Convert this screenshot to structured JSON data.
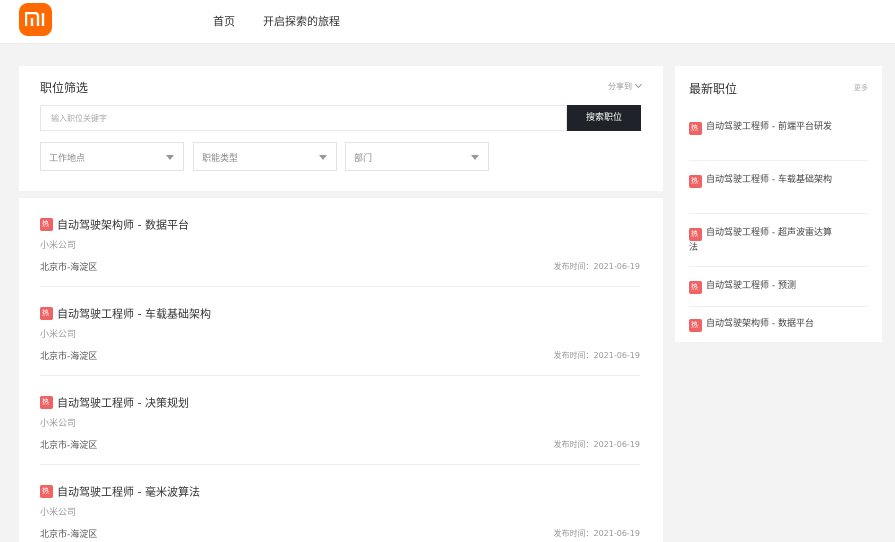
{
  "header": {
    "logo_icon": "mi-logo-icon",
    "brand_color": "#ff6900",
    "nav": [
      {
        "label": "首页"
      },
      {
        "label": "开启探索的旅程"
      }
    ]
  },
  "filter": {
    "title": "职位筛选",
    "share_label": "分享到",
    "search_placeholder": "输入职位关键字",
    "search_button": "搜索职位",
    "selects": [
      {
        "label": "工作地点"
      },
      {
        "label": "职能类型"
      },
      {
        "label": "部门"
      }
    ]
  },
  "jobs": [
    {
      "title": "自动驾驶架构师 - 数据平台",
      "company": "小米公司",
      "location": "北京市-海淀区",
      "date": "发布时间：2021-06-19"
    },
    {
      "title": "自动驾驶工程师 - 车载基础架构",
      "company": "小米公司",
      "location": "北京市-海淀区",
      "date": "发布时间：2021-06-19"
    },
    {
      "title": "自动驾驶工程师 - 决策规划",
      "company": "小米公司",
      "location": "北京市-海淀区",
      "date": "发布时间：2021-06-19"
    },
    {
      "title": "自动驾驶工程师 - 毫米波算法",
      "company": "小米公司",
      "location": "北京市-海淀区",
      "date": "发布时间：2021-06-19"
    }
  ],
  "job_badge": {
    "glyph": "热",
    "icon": "hot-badge-icon",
    "color": "#f06364"
  },
  "latest": {
    "title": "最新职位",
    "more_label": "更多",
    "items": [
      {
        "title": "自动驾驶工程师 - 前端平台研发"
      },
      {
        "title": "自动驾驶工程师 - 车载基础架构"
      },
      {
        "title": "自动驾驶工程师 - 超声波雷达算法"
      },
      {
        "title": "自动驾驶工程师 - 预测"
      },
      {
        "title": "自动驾驶架构师 - 数据平台"
      }
    ]
  }
}
